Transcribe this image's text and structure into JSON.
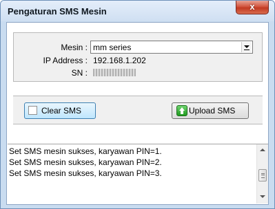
{
  "window": {
    "title": "Pengaturan SMS Mesin",
    "close_label": "x"
  },
  "device": {
    "mesin_label": "Mesin :",
    "mesin_value": "mm series",
    "ip_label": "IP Address :",
    "ip_value": "192.168.1.202",
    "sn_label": "SN :"
  },
  "actions": {
    "clear_label": "Clear SMS",
    "upload_label": "Upload SMS"
  },
  "log": {
    "lines": [
      "Set SMS mesin sukses, karyawan PIN=1.",
      "Set SMS mesin sukses, karyawan PIN=2.",
      "Set SMS mesin sukses, karyawan PIN=3."
    ]
  },
  "icons": {
    "close": "close-icon",
    "upload": "upload-icon",
    "dropdown": "chevron-down-icon"
  },
  "colors": {
    "titlebar": "#cfdff2",
    "close_button": "#c23a22",
    "focused_button": "#bee6fd",
    "upload_icon": "#1f9a1f"
  }
}
